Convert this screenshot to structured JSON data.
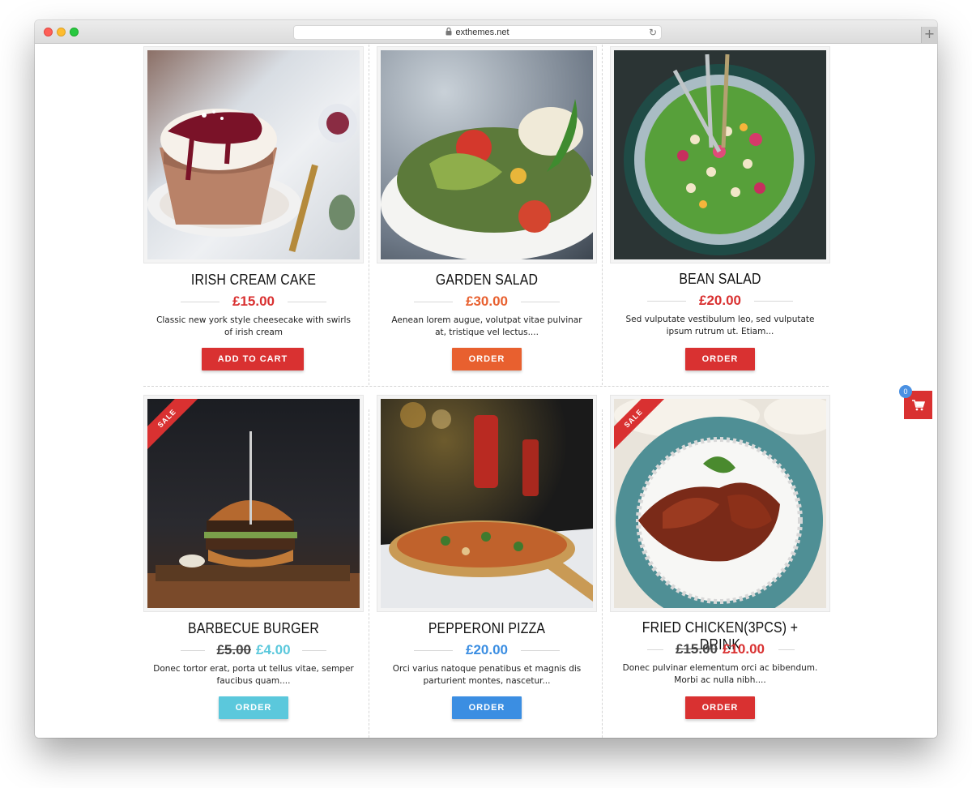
{
  "browser": {
    "url": "exthemes.net"
  },
  "products": [
    {
      "title": "IRISH CREAM CAKE",
      "price": "£15.00",
      "old_price": "",
      "price_color": "#d93131",
      "description": "Classic new york style cheesecake with swirls of irish cream",
      "button": "ADD TO CART",
      "button_color": "#d93131",
      "sale": false
    },
    {
      "title": "GARDEN SALAD",
      "price": "£30.00",
      "old_price": "",
      "price_color": "#e8602f",
      "description": "Aenean lorem augue, volutpat vitae pulvinar at, tristique vel lectus....",
      "button": "ORDER",
      "button_color": "#e8602f",
      "sale": false
    },
    {
      "title": "BEAN SALAD",
      "price": "£20.00",
      "old_price": "",
      "price_color": "#d93131",
      "description": "Sed vulputate vestibulum leo, sed vulputate ipsum rutrum ut. Etiam...",
      "button": "ORDER",
      "button_color": "#d93131",
      "sale": false
    },
    {
      "title": "BARBECUE BURGER",
      "price": "£4.00",
      "old_price": "£5.00",
      "price_color": "#5bc8dc",
      "description": "Donec tortor erat, porta ut tellus vitae, semper faucibus quam....",
      "button": "ORDER",
      "button_color": "#5bc8dc",
      "sale": true,
      "sale_label": "SALE"
    },
    {
      "title": "PEPPERONI PIZZA",
      "price": "£20.00",
      "old_price": "",
      "price_color": "#3b8ee2",
      "description": "Orci varius natoque penatibus et magnis dis parturient montes, nascetur...",
      "button": "ORDER",
      "button_color": "#3b8ee2",
      "sale": false
    },
    {
      "title": "FRIED CHICKEN(3PCS) + DRINK",
      "price": "£10.00",
      "old_price": "£15.00",
      "price_color": "#d93131",
      "description": "Donec pulvinar elementum orci ac bibendum. Morbi ac nulla nibh....",
      "button": "ORDER",
      "button_color": "#d93131",
      "sale": true,
      "sale_label": "SALE"
    }
  ],
  "cart": {
    "count": "0",
    "icon": "cart-icon",
    "color": "#d93131"
  }
}
